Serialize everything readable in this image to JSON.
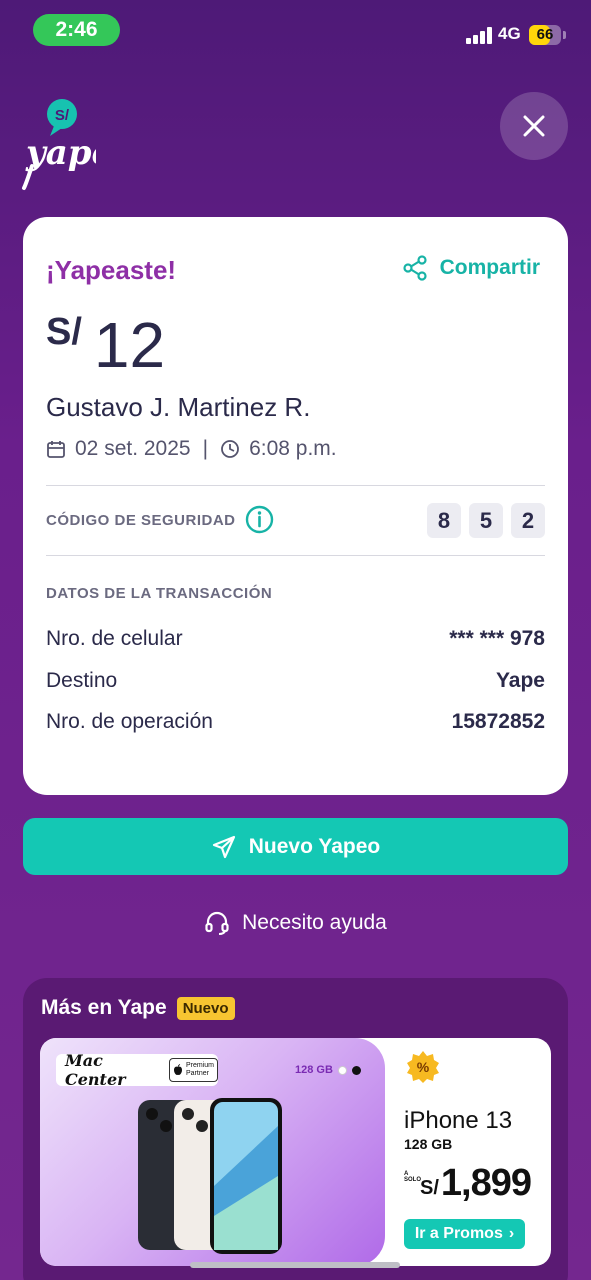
{
  "status_bar": {
    "time": "2:46",
    "network": "4G",
    "battery": "66",
    "battery_fraction": 0.66,
    "time_pill_color": "#34c759",
    "battery_color": "#ffd60a"
  },
  "header": {
    "logo_currency": "S/",
    "logo_word": "yape",
    "close_icon": "close-icon"
  },
  "receipt": {
    "heading": "¡Yapeaste!",
    "share_label": "Compartir",
    "currency": "S/",
    "amount": "12",
    "recipient": "Gustavo J. Martinez R.",
    "date": "02 set. 2025",
    "time": "6:08 p.m.",
    "security_label": "CÓDIGO DE SEGURIDAD",
    "security_code": [
      "8",
      "5",
      "2"
    ],
    "transaction_title": "DATOS DE LA TRANSACCIÓN",
    "rows": [
      {
        "label": "Nro. de celular",
        "value": "*** *** 978"
      },
      {
        "label": "Destino",
        "value": "Yape"
      },
      {
        "label": "Nro. de operación",
        "value": "15872852"
      }
    ]
  },
  "actions": {
    "new_payment": "Nuevo Yapeo",
    "help": "Necesito ayuda"
  },
  "more": {
    "title": "Más en Yape",
    "badge": "Nuevo",
    "promo": {
      "brand": "Mac Center",
      "partner_line1": "Premium",
      "partner_line2": "Partner",
      "storage_tag": "128 GB",
      "product": "iPhone 13",
      "product_storage": "128 GB",
      "price_prefix": "A SOLO",
      "price_currency": "S/",
      "price": "1,899",
      "cta": "Ir a Promos"
    }
  },
  "colors": {
    "accent": "#14c8b4",
    "brand_purple": "#8e2fa6",
    "badge": "#f7c531"
  }
}
